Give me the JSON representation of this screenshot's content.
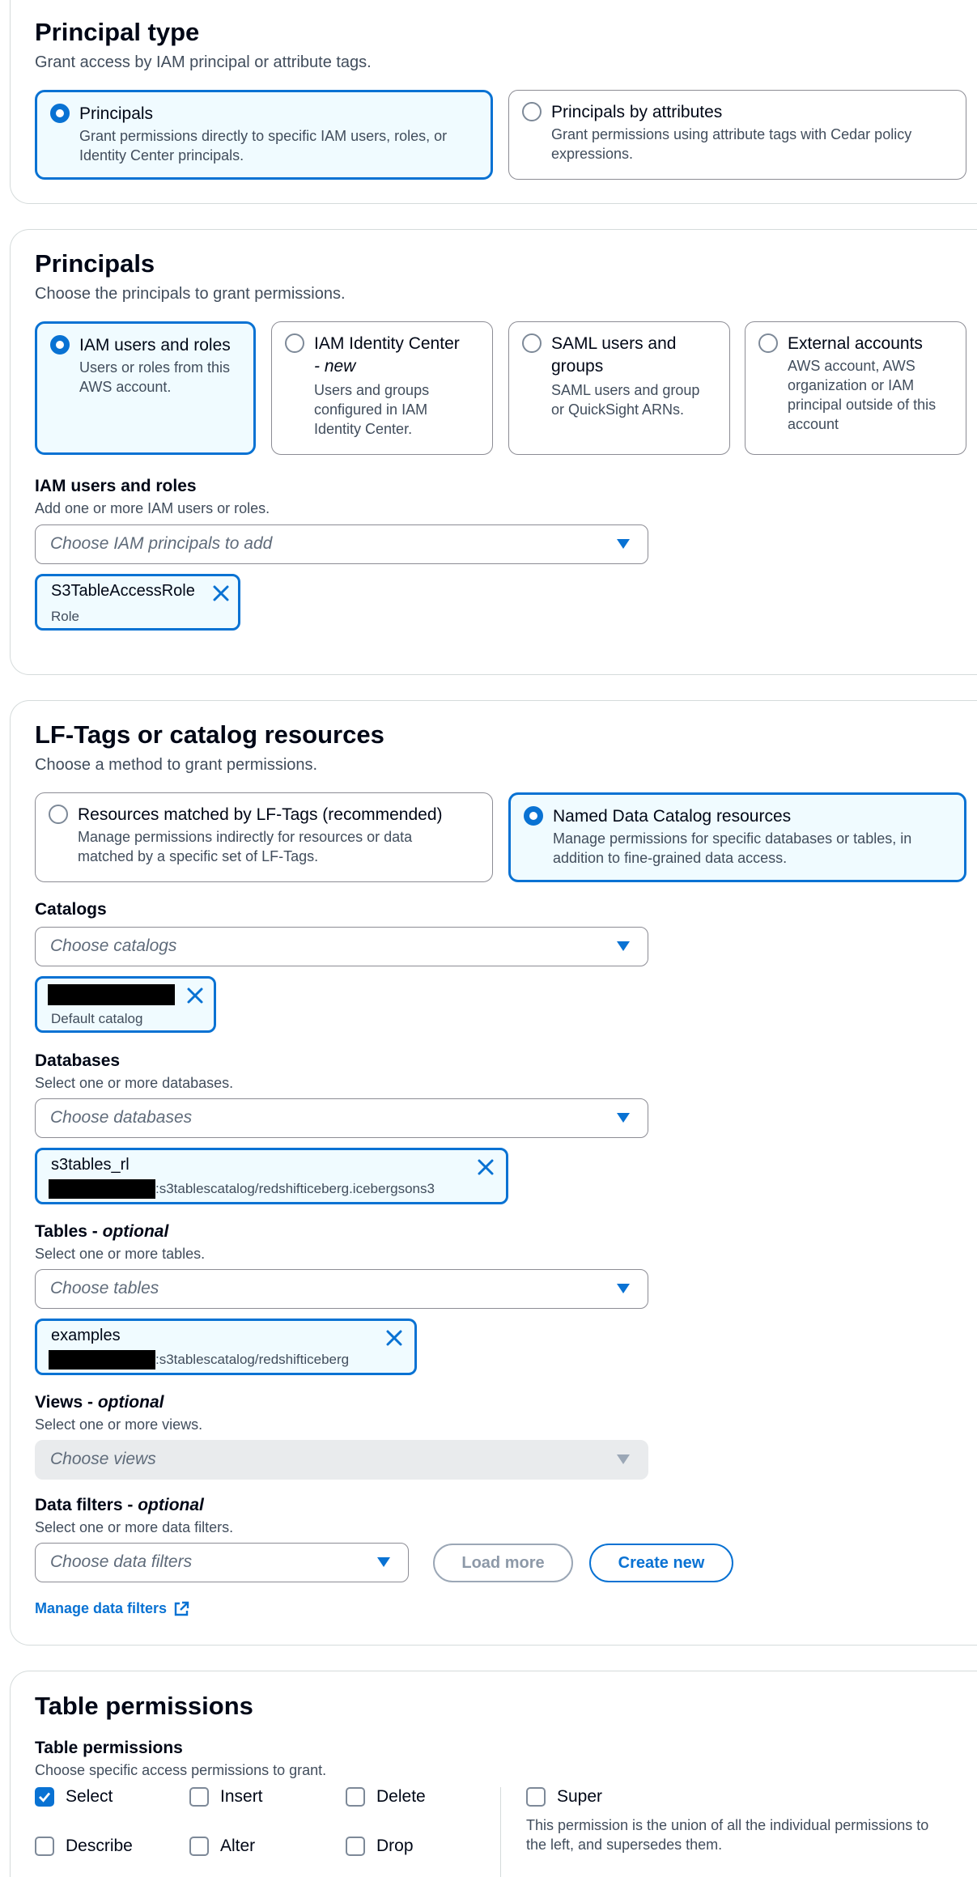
{
  "principal_type": {
    "title": "Principal type",
    "description": "Grant access by IAM principal or attribute tags.",
    "options": [
      {
        "label": "Principals",
        "description_lines": [
          "Grant permissions directly to specific IAM users, roles, or",
          "Identity Center principals."
        ],
        "selected": true
      },
      {
        "label": "Principals by attributes",
        "description_lines": [
          "Grant permissions using attribute tags with Cedar policy",
          "expressions."
        ],
        "selected": false
      }
    ]
  },
  "principals": {
    "title": "Principals",
    "description": "Choose the principals to grant permissions.",
    "options": [
      {
        "label_lines": [
          "IAM users and roles"
        ],
        "label_italic": "",
        "description_lines": [
          "Users or roles from this",
          "AWS account."
        ],
        "selected": true
      },
      {
        "label_lines": [
          "IAM Identity Center"
        ],
        "label_italic": "- new",
        "description_lines": [
          "Users and groups",
          "configured in IAM",
          "Identity Center."
        ],
        "selected": false
      },
      {
        "label_lines": [
          "SAML users and",
          "groups"
        ],
        "label_italic": "",
        "description_lines": [
          "SAML users and group",
          "or QuickSight ARNs."
        ],
        "selected": false
      },
      {
        "label_lines": [
          "External accounts"
        ],
        "label_italic": "",
        "description_lines": [
          "AWS account, AWS",
          "organization or IAM",
          "principal outside of this",
          "account"
        ],
        "selected": false
      }
    ],
    "iam_field": {
      "label": "IAM users and roles",
      "description": "Add one or more IAM users or roles.",
      "placeholder": "Choose IAM principals to add",
      "token": {
        "name": "S3TableAccessRole",
        "sub": "Role"
      }
    }
  },
  "lf_tags": {
    "title": "LF-Tags or catalog resources",
    "description": "Choose a method to grant permissions.",
    "options": [
      {
        "label": "Resources matched by LF-Tags (recommended)",
        "description_lines": [
          "Manage permissions indirectly for resources or data",
          "matched by a specific set of LF-Tags."
        ],
        "selected": false
      },
      {
        "label": "Named Data Catalog resources",
        "description_lines": [
          "Manage permissions for specific databases or tables, in",
          "addition to fine-grained data access."
        ],
        "selected": true
      }
    ],
    "catalogs": {
      "label": "Catalogs",
      "placeholder": "Choose catalogs",
      "token": {
        "sub": "Default catalog"
      }
    },
    "databases": {
      "label": "Databases",
      "description": "Select one or more databases.",
      "placeholder": "Choose databases",
      "token": {
        "name": "s3tables_rl",
        "arn_suffix": ":s3tablescatalog/redshifticeberg.icebergsons3"
      }
    },
    "tables": {
      "label": "Tables -",
      "label_italic": "optional",
      "description": "Select one or more tables.",
      "placeholder": "Choose tables",
      "token": {
        "name": "examples",
        "arn_suffix": ":s3tablescatalog/redshifticeberg"
      }
    },
    "views": {
      "label": "Views -",
      "label_italic": "optional",
      "description": "Select one or more views.",
      "placeholder": "Choose views"
    },
    "data_filters": {
      "label": "Data filters -",
      "label_italic": "optional",
      "description": "Select one or more data filters.",
      "placeholder": "Choose data filters",
      "load_more": "Load more",
      "create_new": "Create new",
      "manage_link": "Manage data filters"
    }
  },
  "table_permissions": {
    "title": "Table permissions",
    "field_label": "Table permissions",
    "field_description": "Choose specific access permissions to grant.",
    "checkboxes": [
      {
        "label": "Select",
        "checked": true
      },
      {
        "label": "Insert",
        "checked": false
      },
      {
        "label": "Delete",
        "checked": false
      },
      {
        "label": "Describe",
        "checked": false
      },
      {
        "label": "Alter",
        "checked": false
      },
      {
        "label": "Drop",
        "checked": false
      }
    ],
    "super": {
      "label": "Super",
      "checked": false,
      "description_lines": [
        "This permission is the union of all the individual permissions to",
        "the left, and supersedes them."
      ]
    }
  },
  "colors": {
    "accent": "#0972d3",
    "selected_bg": "#f0fbff",
    "border": "#8c8c94"
  }
}
